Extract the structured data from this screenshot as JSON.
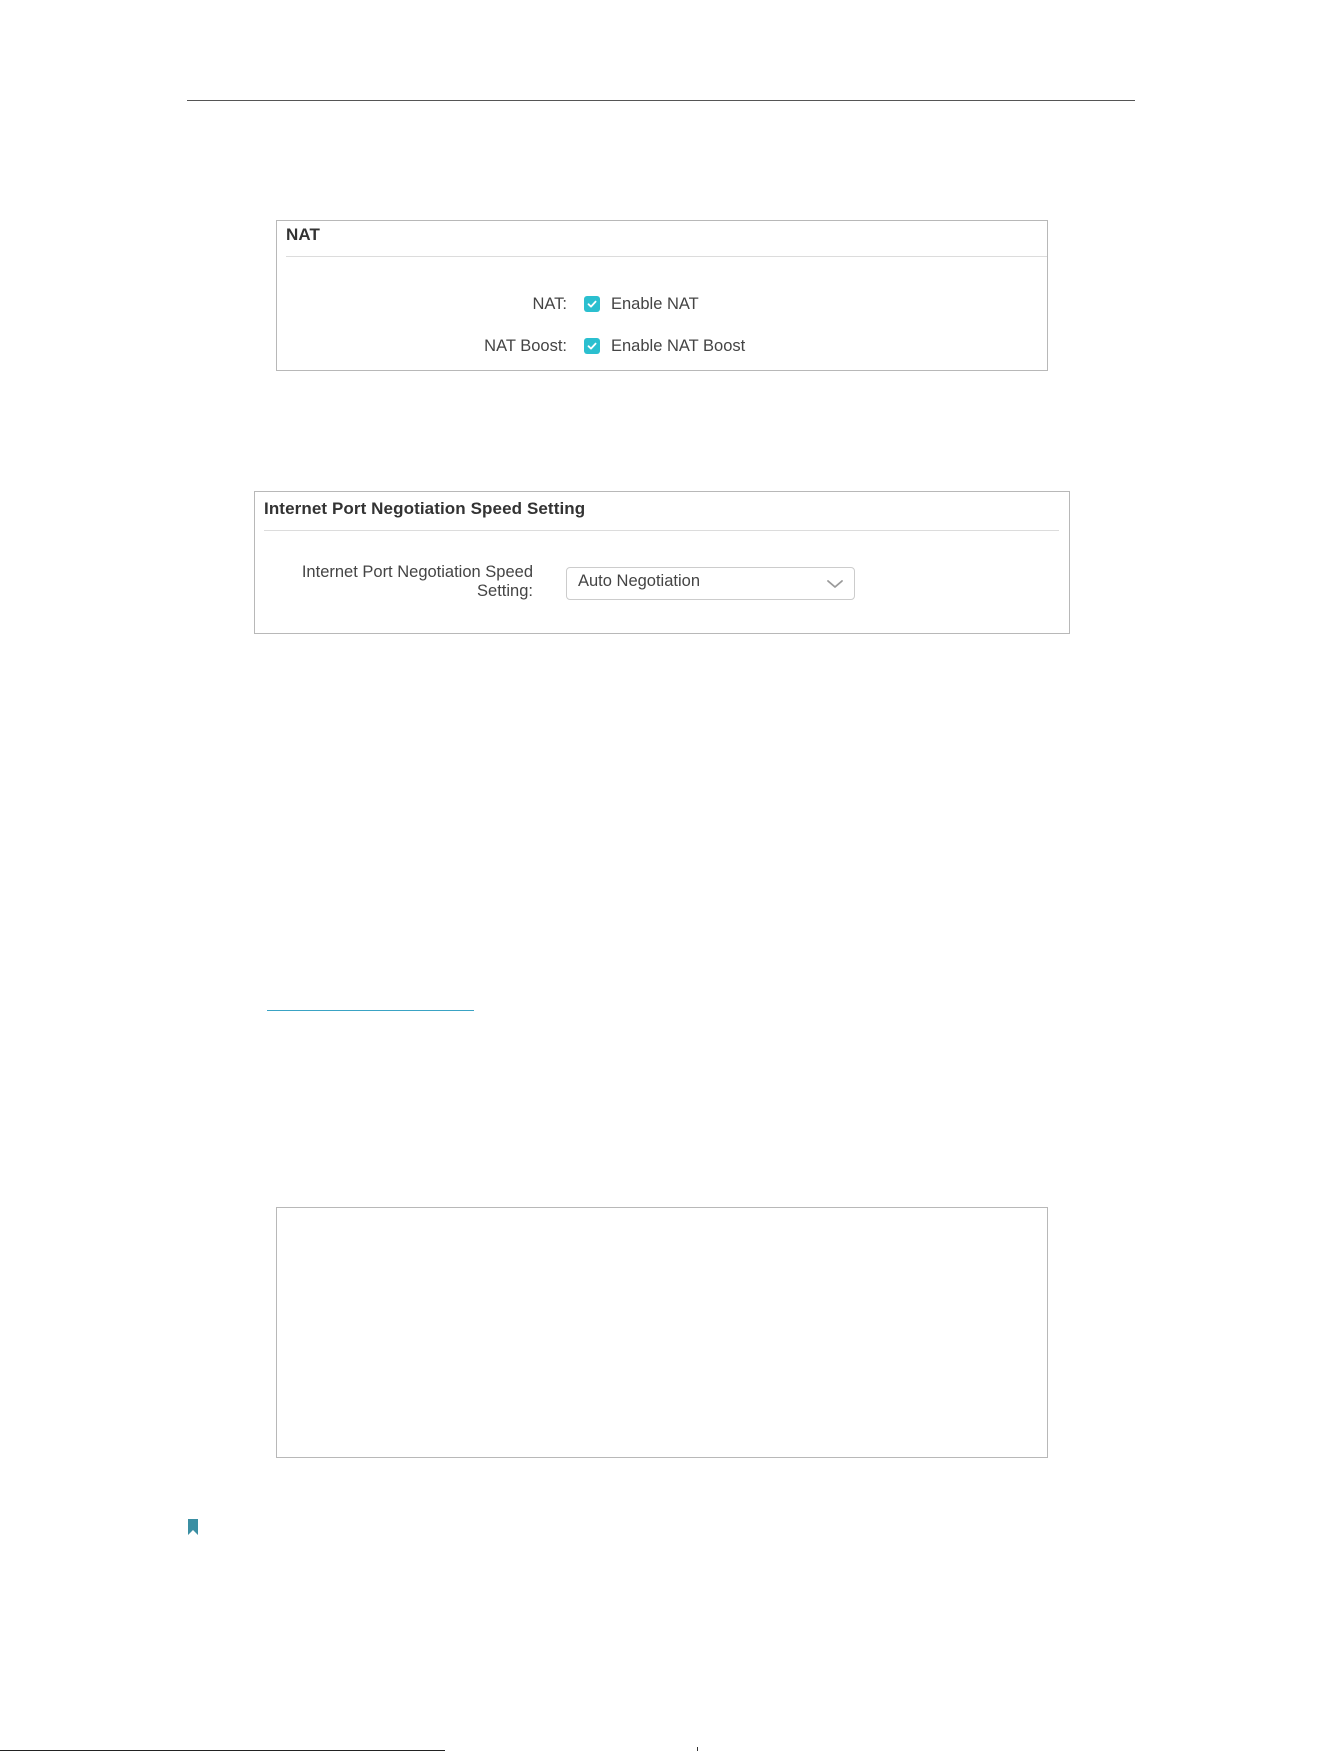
{
  "nat_panel": {
    "title": "NAT",
    "rows": [
      {
        "label": "NAT:",
        "checkbox_text": "Enable NAT",
        "checked": true
      },
      {
        "label": "NAT Boost:",
        "checkbox_text": "Enable NAT Boost",
        "checked": true
      }
    ]
  },
  "speed_panel": {
    "title": "Internet Port Negotiation Speed Setting",
    "label_line1": "Internet Port Negotiation Speed",
    "label_line2": "Setting:",
    "select_value": "Auto Negotiation"
  },
  "colors": {
    "checkbox": "#2bbfcf",
    "link_underline": "#3aa3c4",
    "bookmark": "#3b8fa3"
  },
  "icons": [
    "check-icon",
    "chevron-down-icon",
    "bookmark-icon"
  ]
}
